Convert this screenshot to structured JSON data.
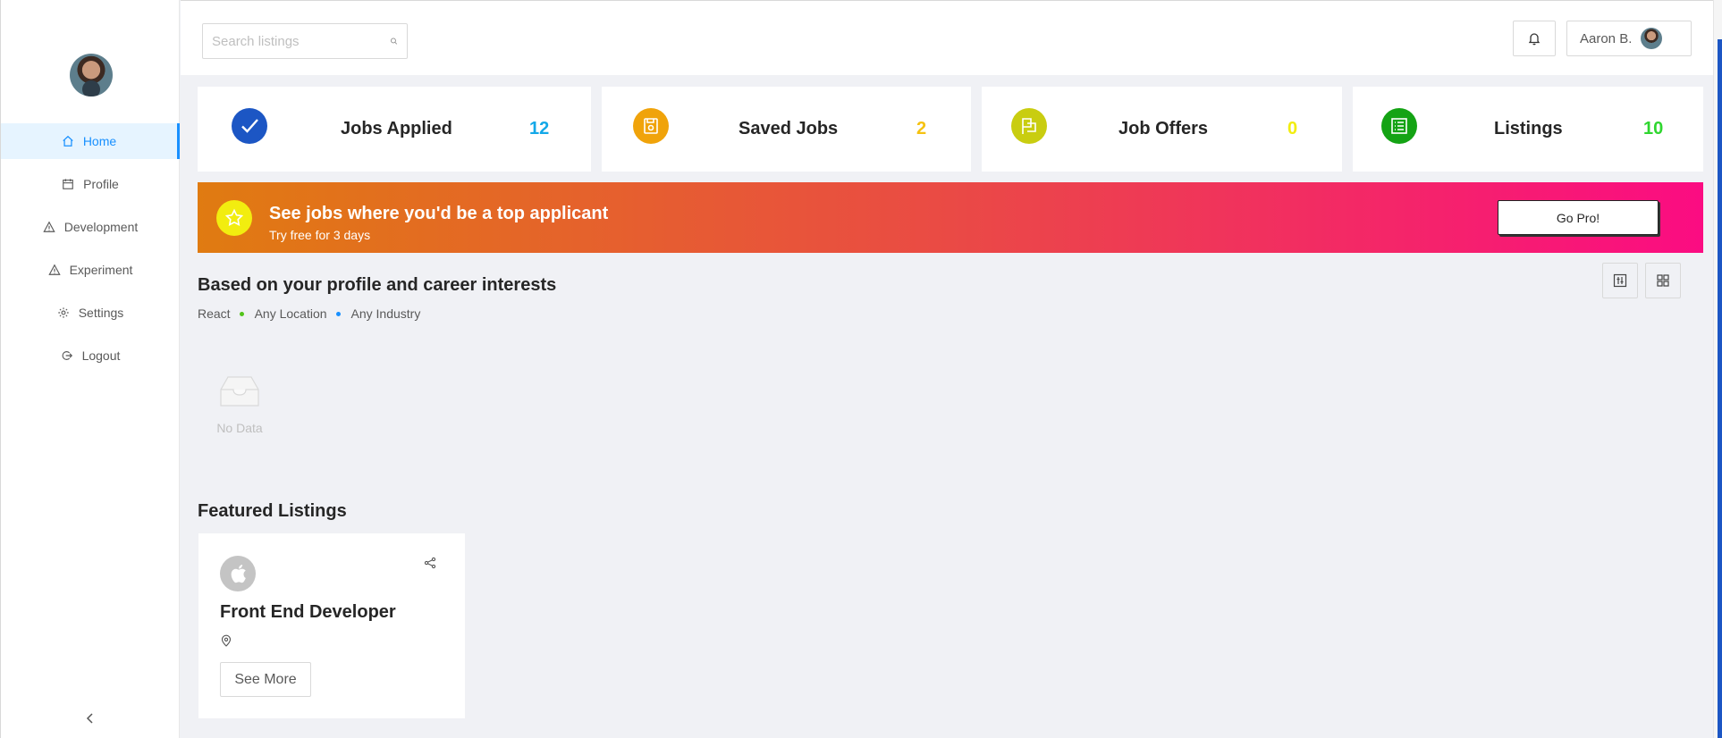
{
  "sidebar": {
    "items": [
      {
        "label": "Home",
        "icon": "home-icon",
        "active": true
      },
      {
        "label": "Profile",
        "icon": "calendar-icon"
      },
      {
        "label": "Development",
        "icon": "warning-icon"
      },
      {
        "label": "Experiment",
        "icon": "warning-icon"
      },
      {
        "label": "Settings",
        "icon": "gear-icon"
      },
      {
        "label": "Logout",
        "icon": "logout-icon"
      }
    ]
  },
  "header": {
    "search_placeholder": "Search listings",
    "user_name": "Aaron B."
  },
  "stats": [
    {
      "label": "Jobs Applied",
      "count": "12",
      "color": "#13a8e8",
      "icon_color": "#1c56c4"
    },
    {
      "label": "Saved Jobs",
      "count": "2",
      "color": "#f5c211",
      "icon_color": "#f0a30a"
    },
    {
      "label": "Job Offers",
      "count": "0",
      "color": "#f2ed0f",
      "icon_color": "#c9cd10"
    },
    {
      "label": "Listings",
      "count": "10",
      "color": "#2fd62f",
      "icon_color": "#14a314"
    }
  ],
  "banner": {
    "title": "See jobs where you'd be a top applicant",
    "subtitle": "Try free for 3 days",
    "button": "Go Pro!"
  },
  "recommendations": {
    "title": "Based on your profile and career interests",
    "tags": [
      "React",
      "Any Location",
      "Any Industry"
    ],
    "tag_dot_colors": [
      "#52c41a",
      "#1890ff"
    ],
    "empty_text": "No Data"
  },
  "featured": {
    "title": "Featured Listings",
    "listing": {
      "job_title": "Front End Developer",
      "button": "See More"
    }
  }
}
